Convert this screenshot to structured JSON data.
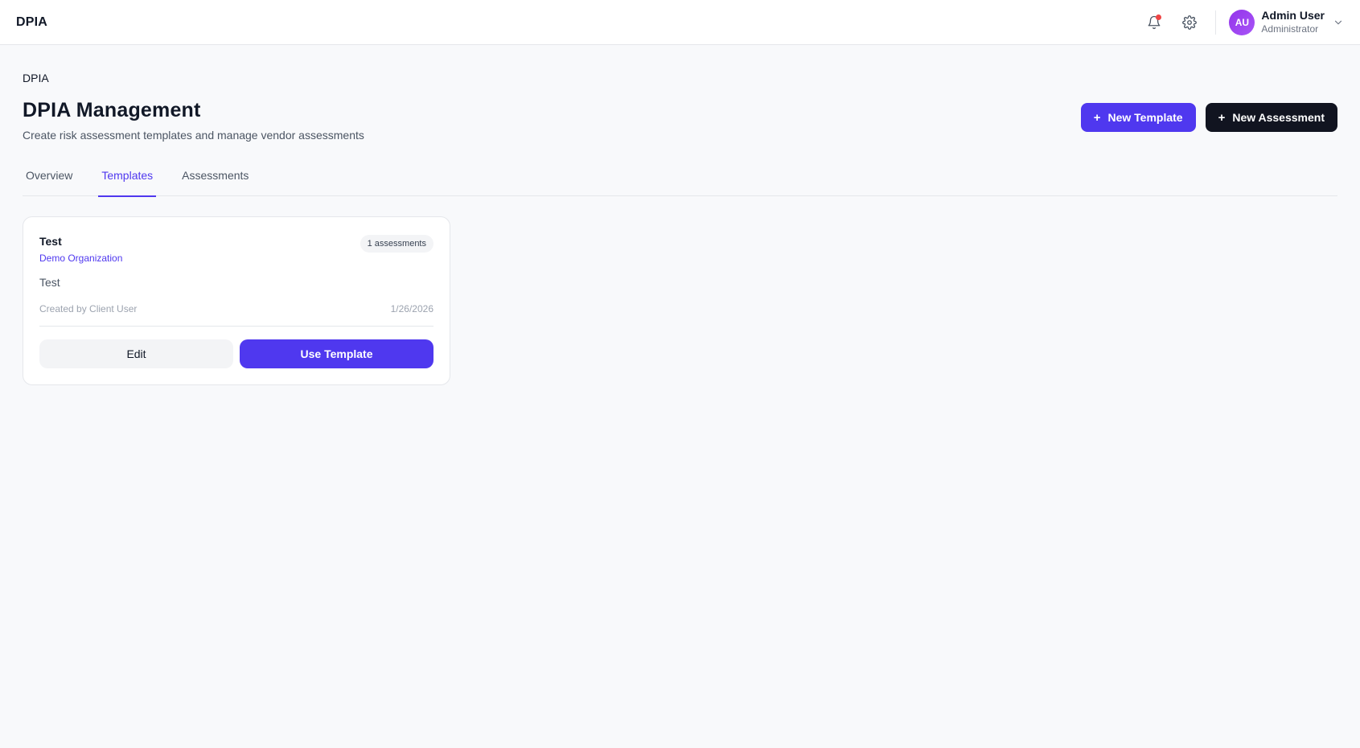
{
  "app": {
    "brand": "DPIA"
  },
  "header": {
    "notification_icon": "bell-icon",
    "settings_icon": "gear-icon",
    "user": {
      "initials": "AU",
      "name": "Admin User",
      "role": "Administrator"
    }
  },
  "page": {
    "breadcrumb": "DPIA",
    "title": "DPIA Management",
    "subtitle": "Create risk assessment templates and manage vendor assessments",
    "new_template_label": "New Template",
    "new_assessment_label": "New Assessment"
  },
  "tabs": [
    {
      "label": "Overview",
      "active": false
    },
    {
      "label": "Templates",
      "active": true
    },
    {
      "label": "Assessments",
      "active": false
    }
  ],
  "templates": [
    {
      "title": "Test",
      "organization": "Demo Organization",
      "badge": "1 assessments",
      "description": "Test",
      "created_by": "Created by Client User",
      "date": "1/26/2026",
      "edit_label": "Edit",
      "use_label": "Use Template"
    }
  ],
  "colors": {
    "accent": "#4f38ef",
    "dark_button": "#111420",
    "notification_dot": "#ef4444",
    "avatar": "#9333ea"
  }
}
